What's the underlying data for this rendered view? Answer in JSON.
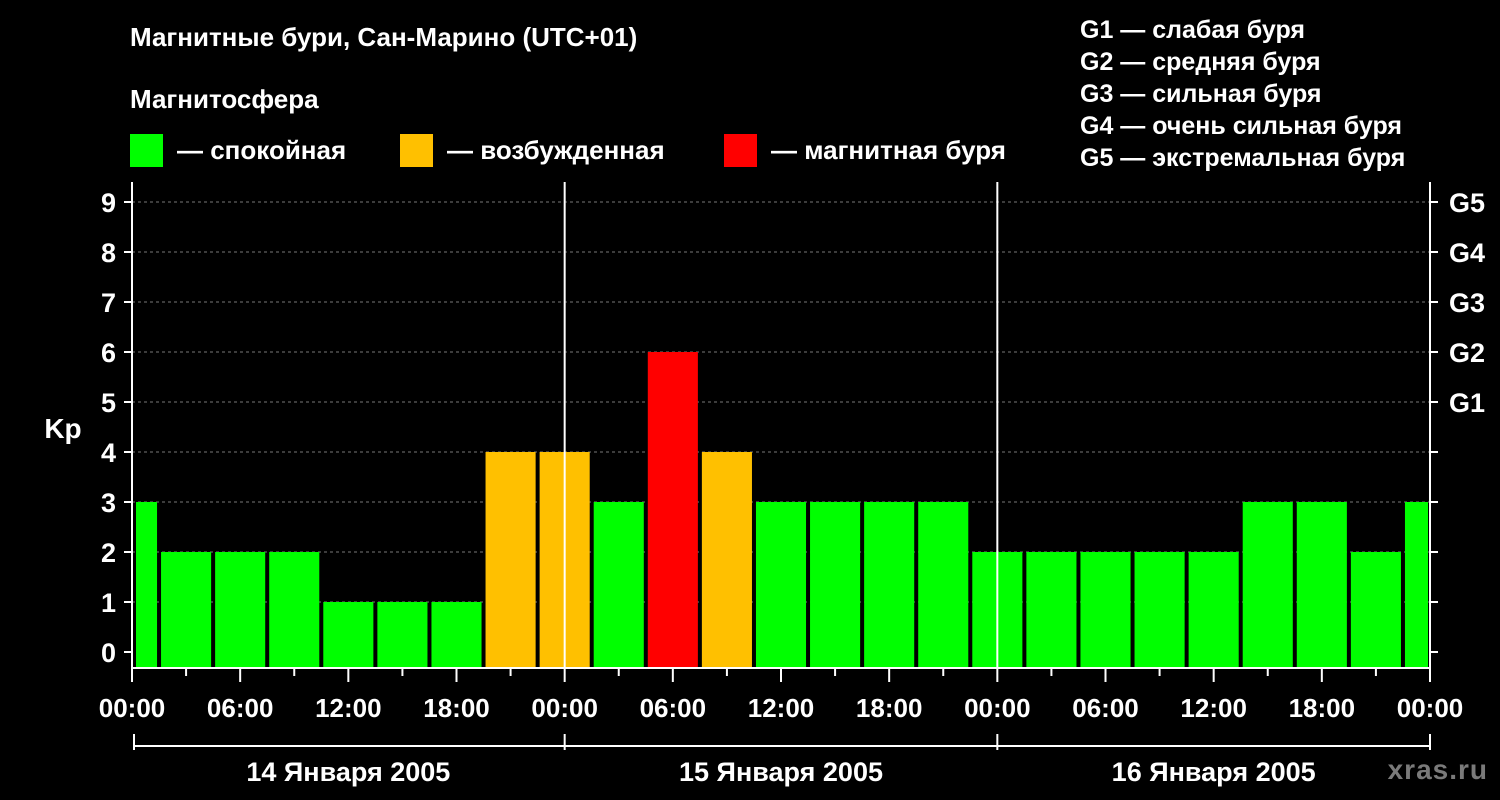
{
  "chart_data": {
    "type": "bar",
    "title": "Магнитные бури, Сан-Марино (UTC+01)",
    "subtitle": "Магнитосфера",
    "ylabel": "Kp",
    "ylim": [
      0,
      9
    ],
    "y_ticks": [
      "0",
      "1",
      "2",
      "3",
      "4",
      "5",
      "6",
      "7",
      "8",
      "9"
    ],
    "g_scale": [
      {
        "kp": 5,
        "label": "G1"
      },
      {
        "kp": 6,
        "label": "G2"
      },
      {
        "kp": 7,
        "label": "G3"
      },
      {
        "kp": 8,
        "label": "G4"
      },
      {
        "kp": 9,
        "label": "G5"
      }
    ],
    "x_ticks": [
      "00:00",
      "06:00",
      "12:00",
      "18:00",
      "00:00",
      "06:00",
      "12:00",
      "18:00",
      "00:00",
      "06:00",
      "12:00",
      "18:00",
      "00:00"
    ],
    "days": [
      "14 Января 2005",
      "15 Января 2005",
      "16 Января 2005"
    ],
    "values": [
      3,
      2,
      2,
      2,
      1,
      1,
      1,
      4,
      4,
      3,
      6,
      4,
      3,
      3,
      3,
      3,
      2,
      2,
      2,
      2,
      2,
      3,
      3,
      2,
      3
    ],
    "status_colors": {
      "quiet": "#00ff00",
      "disturbed": "#ffc000",
      "storm": "#ff0000"
    },
    "legend": [
      {
        "color": "#00ff00",
        "label": "— спокойная"
      },
      {
        "color": "#ffc000",
        "label": "— возбужденная"
      },
      {
        "color": "#ff0000",
        "label": "— магнитная буря"
      }
    ],
    "grid": true
  },
  "g_legend": [
    "G1 — слабая буря",
    "G2 — средняя буря",
    "G3 — сильная буря",
    "G4 — очень сильная буря",
    "G5 — экстремальная буря"
  ],
  "watermark": "xras.ru"
}
